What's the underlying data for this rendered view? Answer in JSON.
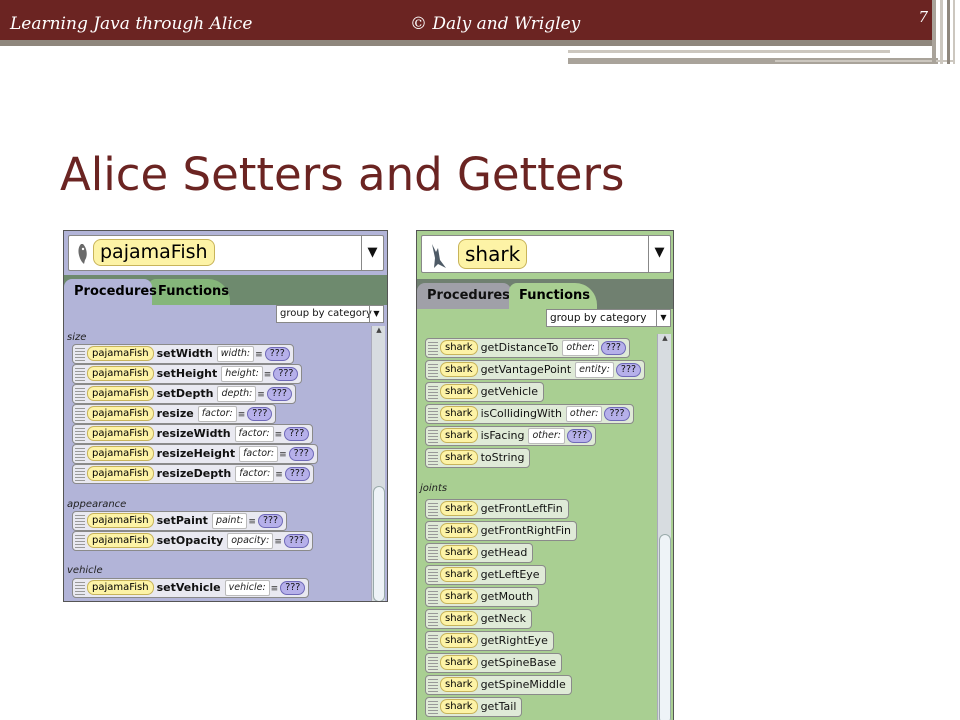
{
  "slide": {
    "header_left": "Learning Java through Alice",
    "header_center": "© Daly and Wrigley",
    "page_number": "7",
    "title": "Alice Setters and Getters"
  },
  "procedures_panel": {
    "object_name": "pajamaFish",
    "tabs": [
      "Procedures",
      "Functions"
    ],
    "active_tab": "Procedures",
    "group_dropdown": "group by category",
    "categories": [
      {
        "label": "size",
        "tiles": [
          {
            "receiver": "pajamaFish",
            "method": "setWidth",
            "param": "width:",
            "value": "???"
          },
          {
            "receiver": "pajamaFish",
            "method": "setHeight",
            "param": "height:",
            "value": "???"
          },
          {
            "receiver": "pajamaFish",
            "method": "setDepth",
            "param": "depth:",
            "value": "???"
          },
          {
            "receiver": "pajamaFish",
            "method": "resize",
            "param": "factor:",
            "value": "???"
          },
          {
            "receiver": "pajamaFish",
            "method": "resizeWidth",
            "param": "factor:",
            "value": "???"
          },
          {
            "receiver": "pajamaFish",
            "method": "resizeHeight",
            "param": "factor:",
            "value": "???"
          },
          {
            "receiver": "pajamaFish",
            "method": "resizeDepth",
            "param": "factor:",
            "value": "???"
          }
        ]
      },
      {
        "label": "appearance",
        "tiles": [
          {
            "receiver": "pajamaFish",
            "method": "setPaint",
            "param": "paint:",
            "value": "???"
          },
          {
            "receiver": "pajamaFish",
            "method": "setOpacity",
            "param": "opacity:",
            "value": "???"
          }
        ]
      },
      {
        "label": "vehicle",
        "tiles": [
          {
            "receiver": "pajamaFish",
            "method": "setVehicle",
            "param": "vehicle:",
            "value": "???"
          }
        ]
      }
    ]
  },
  "functions_panel": {
    "object_name": "shark",
    "tabs": [
      "Procedures",
      "Functions"
    ],
    "active_tab": "Functions",
    "group_dropdown": "group by category",
    "tiles": [
      {
        "receiver": "shark",
        "method": "getDistanceTo",
        "param": "other:",
        "value": "???"
      },
      {
        "receiver": "shark",
        "method": "getVantagePoint",
        "param": "entity:",
        "value": "???"
      },
      {
        "receiver": "shark",
        "method": "getVehicle"
      },
      {
        "receiver": "shark",
        "method": "isCollidingWith",
        "param": "other:",
        "value": "???"
      },
      {
        "receiver": "shark",
        "method": "isFacing",
        "param": "other:",
        "value": "???"
      },
      {
        "receiver": "shark",
        "method": "toString"
      }
    ],
    "joints_label": "joints",
    "joint_tiles": [
      {
        "receiver": "shark",
        "method": "getFrontLeftFin"
      },
      {
        "receiver": "shark",
        "method": "getFrontRightFin"
      },
      {
        "receiver": "shark",
        "method": "getHead"
      },
      {
        "receiver": "shark",
        "method": "getLeftEye"
      },
      {
        "receiver": "shark",
        "method": "getMouth"
      },
      {
        "receiver": "shark",
        "method": "getNeck"
      },
      {
        "receiver": "shark",
        "method": "getRightEye"
      },
      {
        "receiver": "shark",
        "method": "getSpineBase"
      },
      {
        "receiver": "shark",
        "method": "getSpineMiddle"
      },
      {
        "receiver": "shark",
        "method": "getTail"
      }
    ]
  },
  "colors": {
    "header_bar": "#6b2422",
    "title": "#6b2422",
    "procedures_bg": "#b2b4d8",
    "functions_bg": "#a9cf92",
    "receiver_chip": "#fdf3a6",
    "value_chip": "#b6b0ea"
  }
}
